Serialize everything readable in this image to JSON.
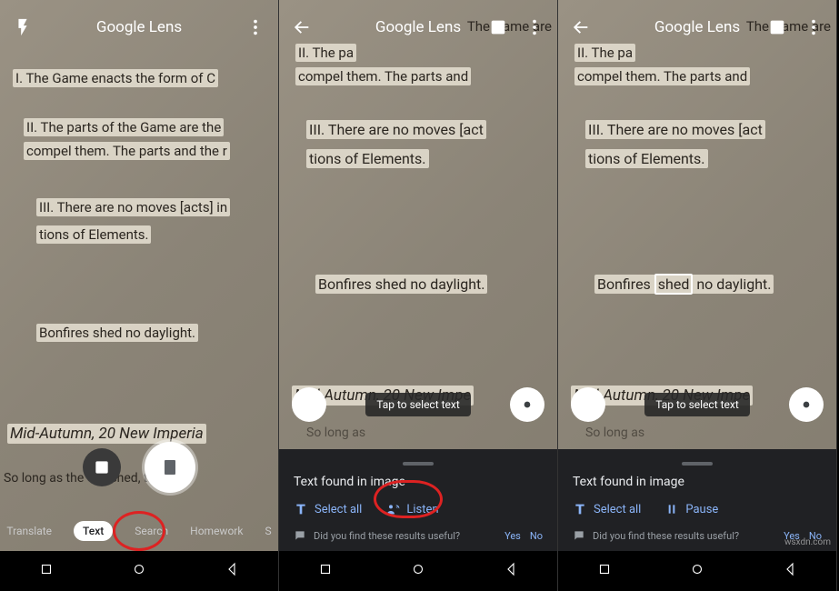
{
  "app_title": "Google Lens",
  "screens": {
    "s1": {
      "lines": {
        "l1": "I. The Game enacts the form of C",
        "l2a": "II. The parts of the Game are the",
        "l2b": "compel them. The parts and the r",
        "l3a": "III. There are no moves [acts] in",
        "l3b": "tions of Elements.",
        "l4": "Bonfires shed no daylight.",
        "l5": "Mid-Autumn, 20 New Imperia",
        "l6a": "So long as the",
        "l6b": "tched, the littl"
      },
      "modes": [
        "Translate",
        "Text",
        "Search",
        "Homework",
        "S"
      ]
    },
    "s23": {
      "lines": {
        "top1": "The Game are",
        "l2a": "II. The pa",
        "l2b": "compel them. The parts and",
        "l3a": "III. There are no moves [act",
        "l3b": "tions of Elements.",
        "l4_pre": "Bonfires ",
        "l4_word": "shed",
        "l4_post": " no daylight.",
        "l4_full": "Bonfires shed no daylight.",
        "l5": "Mid-Autumn, 20 New Impe",
        "l6": "So long as"
      },
      "tap_hint": "Tap to select text",
      "sheet_title": "Text found in image",
      "select_all": "Select all",
      "listen": "Listen",
      "pause": "Pause",
      "feedback_q": "Did you find these results useful?",
      "yes": "Yes",
      "no": "No"
    }
  },
  "watermark": "wsxdn.com"
}
